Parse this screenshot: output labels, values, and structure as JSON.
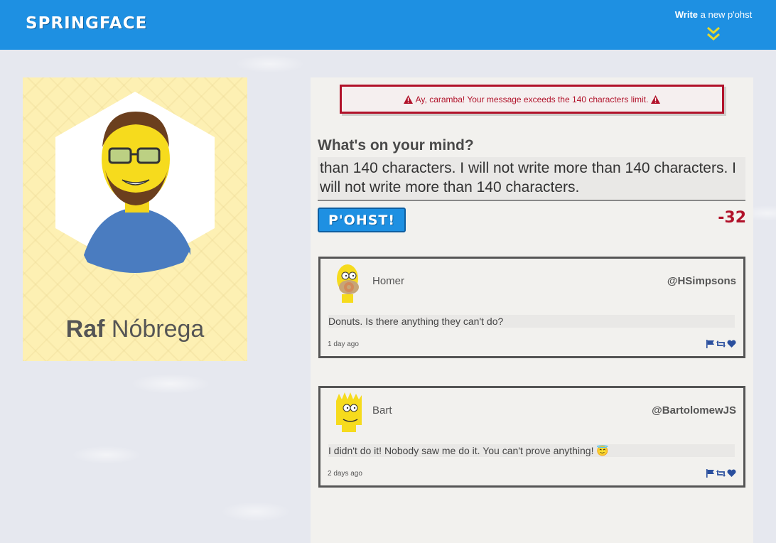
{
  "header": {
    "logo": "SPRINGFACE",
    "write_bold": "Write",
    "write_rest": " a new p'ohst",
    "accent": "#1e90e2"
  },
  "profile": {
    "first_name": "Raf",
    "last_name": "Nóbrega"
  },
  "composer": {
    "alert_text": "Ay, caramba! Your message exceeds the 140 characters limit.",
    "label": "What's on your mind?",
    "value": "than 140 characters. I will not write more than 140 characters. I will not write more than 140 characters.",
    "post_button": "P'OHST!",
    "char_counter": "-32"
  },
  "posts": [
    {
      "name": "Homer",
      "handle": "@HSimpsons",
      "body": "Donuts. Is there anything they can't do?",
      "time": "1 day ago",
      "icons": [
        "flag-icon",
        "retweet-icon",
        "heart-icon"
      ]
    },
    {
      "name": "Bart",
      "handle": "@BartolomewJS",
      "body": "I didn't do it! Nobody saw me do it. You can't prove anything! 😇",
      "time": "2 days ago",
      "icons": [
        "flag-icon",
        "retweet-icon",
        "heart-icon"
      ]
    }
  ]
}
